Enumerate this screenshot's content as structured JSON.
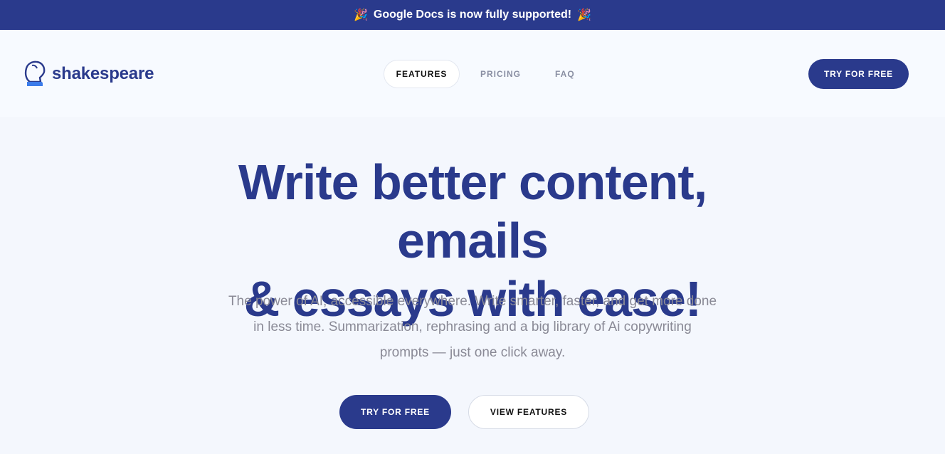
{
  "banner": {
    "emoji_left": "🎉",
    "text": "Google Docs is now fully supported!",
    "emoji_right": "🎉"
  },
  "logo": {
    "icon": "bust-icon",
    "text": "shakespeare"
  },
  "nav": {
    "items": [
      {
        "label": "FEATURES",
        "active": true
      },
      {
        "label": "PRICING",
        "active": false
      },
      {
        "label": "FAQ",
        "active": false
      }
    ],
    "cta_label": "TRY FOR FREE"
  },
  "hero": {
    "title_line1": "Write better content, emails",
    "title_line2": "& essays with ease!",
    "subtitle": "The power of AI, accessible everywhere. Write smarter, faster, and get more done in less time. Summarization, rephrasing and a big library of Ai copywriting prompts — just one click away.",
    "primary_cta": "TRY FOR FREE",
    "secondary_cta": "VIEW FEATURES"
  },
  "colors": {
    "brand": "#2a3a8c",
    "background": "#f4f7fd",
    "muted_text": "#8a8a96"
  }
}
